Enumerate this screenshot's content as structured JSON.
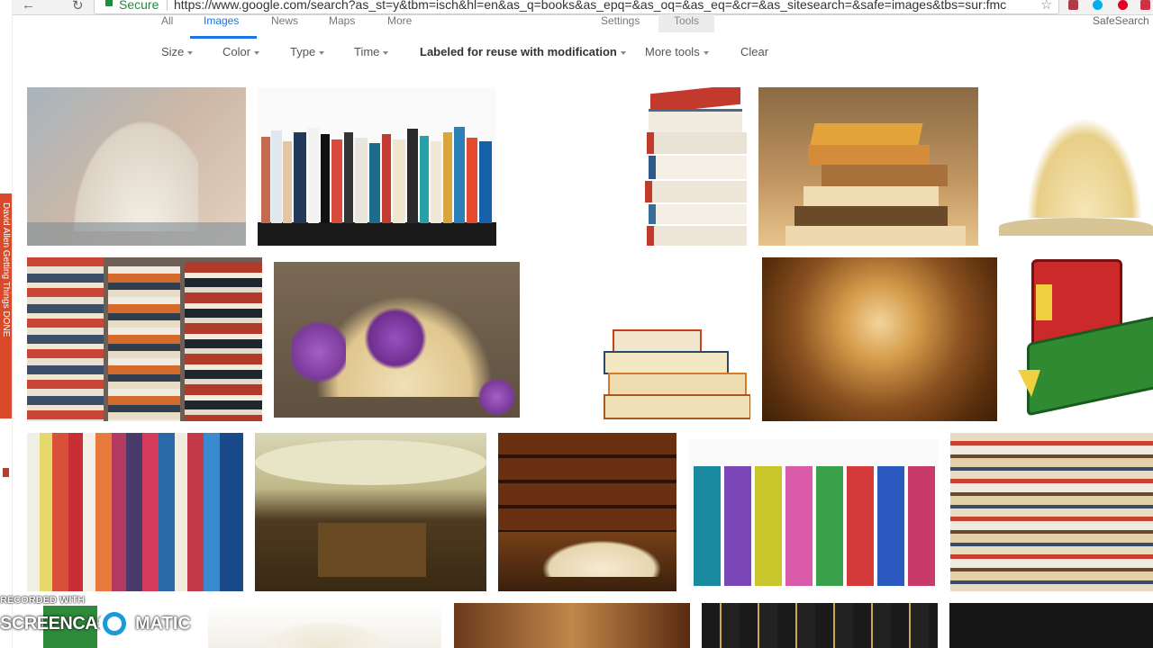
{
  "browser": {
    "secure_label": "Secure",
    "url": "https://www.google.com/search?as_st=y&tbm=isch&hl=en&as_q=books&as_epq=&as_oq=&as_eq=&cr=&as_sitesearch=&safe=images&tbs=sur:fmc"
  },
  "side_window": {
    "text": "David Allen Getting Things DONE"
  },
  "google_tabs": {
    "all": "All",
    "images": "Images",
    "news": "News",
    "maps": "Maps",
    "more": "More",
    "settings": "Settings",
    "tools": "Tools",
    "safesearch": "SafeSearch"
  },
  "filters": {
    "size": "Size",
    "color": "Color",
    "type": "Type",
    "time": "Time",
    "usage_rights": "Labeled for reuse with modification",
    "more_tools": "More tools",
    "clear": "Clear"
  },
  "watermark": {
    "recorded_with": "RECORDED WITH",
    "brand_left": "SCREENCAST",
    "brand_right": "MATIC"
  },
  "colors": {
    "accent": "#1a73e8",
    "secure": "#1e8e3e"
  }
}
